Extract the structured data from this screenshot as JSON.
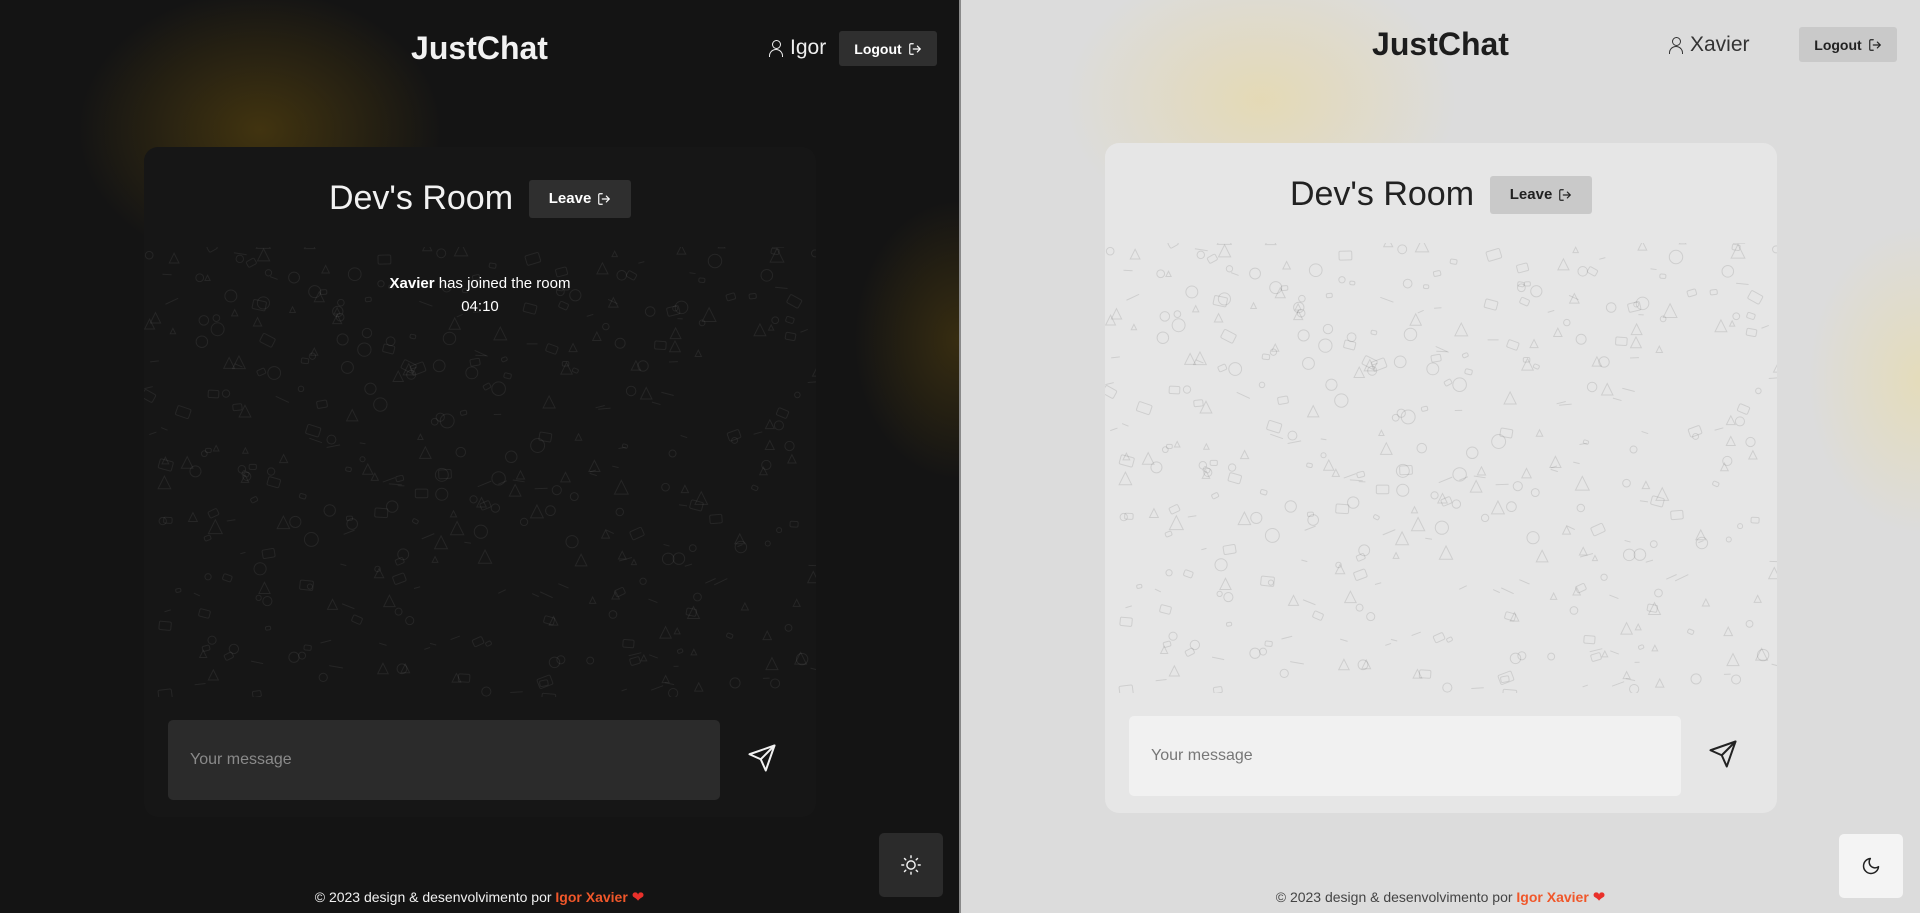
{
  "panes": {
    "dark": {
      "brand": "JustChat",
      "username": "Igor",
      "logout_label": "Logout",
      "room_title": "Dev's Room",
      "leave_label": "Leave",
      "system_message": {
        "user": "Xavier",
        "text": "has joined the room",
        "time": "04:10"
      },
      "message_placeholder": "Your message",
      "theme_toggle_icon": "sun-icon"
    },
    "light": {
      "brand": "JustChat",
      "username": "Xavier",
      "logout_label": "Logout",
      "room_title": "Dev's Room",
      "leave_label": "Leave",
      "message_placeholder": "Your message",
      "theme_toggle_icon": "moon-icon"
    }
  },
  "footer": {
    "text": "© 2023 design & desenvolvimento por",
    "author": "Igor Xavier",
    "heart": "❤"
  },
  "colors": {
    "dark_bg": "#141414",
    "light_bg": "#dcdcdc",
    "accent": "#f0572a",
    "heart": "#e9302a"
  }
}
